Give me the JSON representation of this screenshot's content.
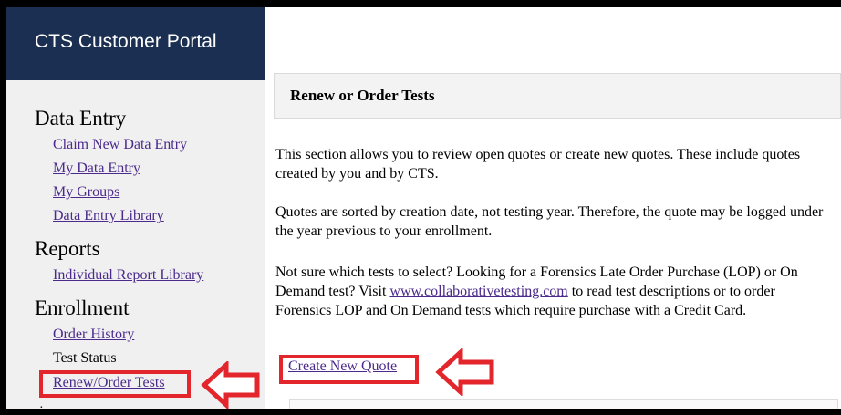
{
  "portal": {
    "title": "CTS Customer Portal"
  },
  "sidebar": {
    "data_entry": {
      "heading": "Data Entry",
      "items": [
        "Claim New Data Entry",
        "My Data Entry",
        "My Groups",
        "Data Entry Library"
      ]
    },
    "reports": {
      "heading": "Reports",
      "items": [
        "Individual Report Library"
      ]
    },
    "enrollment": {
      "heading": "Enrollment",
      "items": [
        "Order History",
        "Test Status",
        "Renew/Order Tests"
      ]
    }
  },
  "main": {
    "title": "Renew or Order Tests",
    "para1": "This section allows you to review open quotes or create new quotes. These include quotes created by you and by CTS.",
    "para2": "Quotes are sorted by creation date, not testing year. Therefore, the quote may be logged under the year previous to your enrollment.",
    "para3_before": "Not sure which tests to select? Looking for a Forensics Late Order Purchase (LOP) or On Demand test? Visit ",
    "para3_link": "www.collaborativetesting.com",
    "para3_after": " to read test descriptions or to order Forensics LOP and On Demand tests which require purchase with a Credit Card.",
    "create_quote_label": "Create New Quote"
  },
  "colors": {
    "header_bg": "#1b2f52",
    "link": "#4b2a8c",
    "annotation_red": "#e2262b"
  },
  "icons": [
    "left-arrow-annotation-icon"
  ]
}
